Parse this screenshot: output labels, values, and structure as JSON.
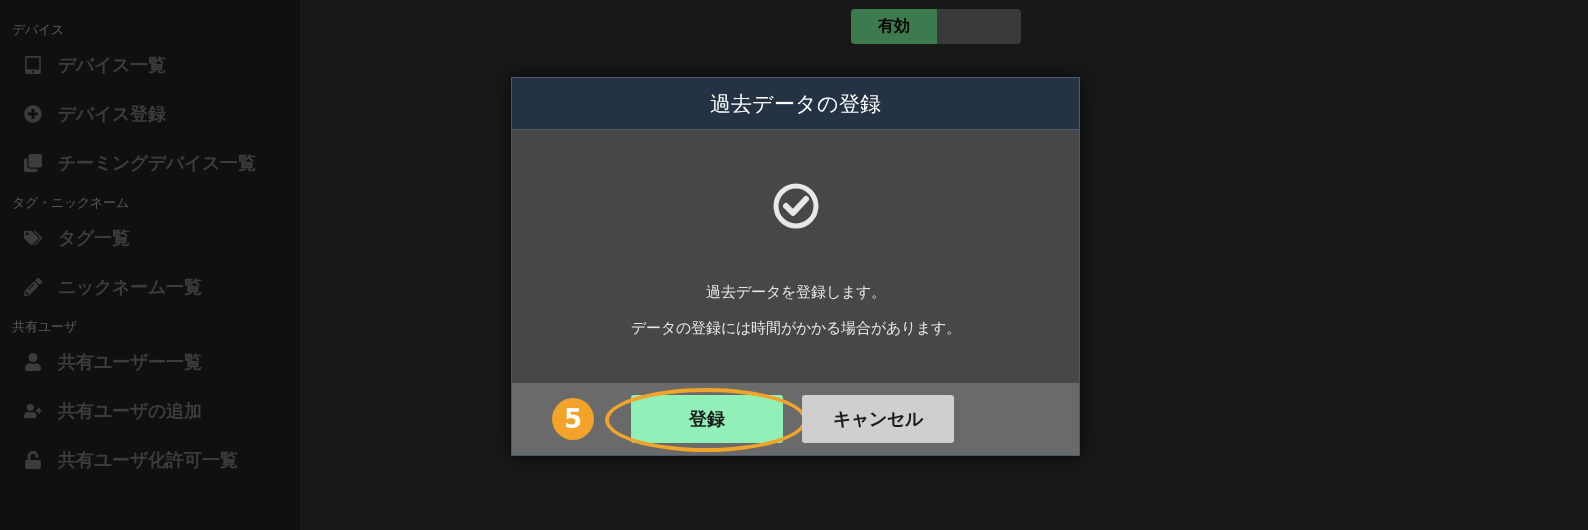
{
  "sidebar": {
    "sections": [
      {
        "label": "デバイス",
        "items": [
          "デバイス一覧",
          "デバイス登録",
          "チーミングデバイス一覧"
        ]
      },
      {
        "label": "タグ・ニックネーム",
        "items": [
          "タグ一覧",
          "ニックネーム一覧"
        ]
      },
      {
        "label": "共有ユーザ",
        "items": [
          "共有ユーザー一覧",
          "共有ユーザの追加",
          "共有ユーザ化許可一覧"
        ]
      }
    ]
  },
  "toggle": {
    "label": "有効",
    "on": true
  },
  "dialog": {
    "title": "過去データの登録",
    "messages": [
      "過去データを登録します。",
      "データの登録には時間がかかる場合があります。"
    ],
    "buttons": [
      {
        "label": "登録",
        "kind": "primary",
        "highlighted": true
      },
      {
        "label": "キャンセル",
        "kind": "secondary",
        "highlighted": false
      }
    ],
    "step_badge": "5"
  }
}
